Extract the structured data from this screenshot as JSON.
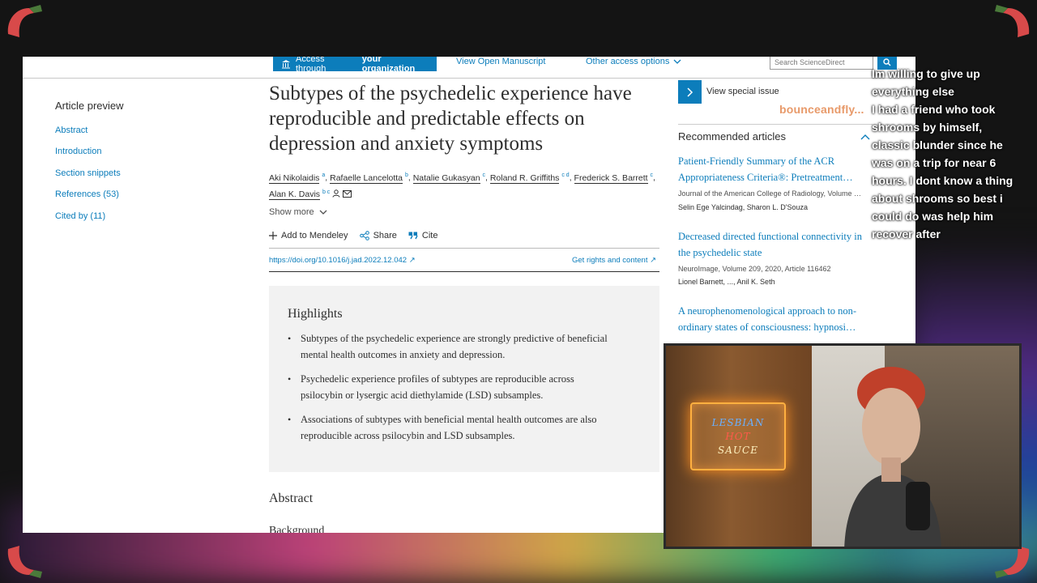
{
  "topbar": {
    "access_prefix": "Access through",
    "access_org": "your organization",
    "view_manuscript": "View Open Manuscript",
    "other_access": "Other access options",
    "search_placeholder": "Search ScienceDirect"
  },
  "nav": {
    "title": "Article preview",
    "items": [
      {
        "label": "Abstract"
      },
      {
        "label": "Introduction"
      },
      {
        "label": "Section snippets"
      },
      {
        "label": "References (53)"
      },
      {
        "label": "Cited by (11)"
      }
    ]
  },
  "article": {
    "title": "Subtypes of the psychedelic experience have reproducible and predictable effects on depression and anxiety symptoms",
    "authors": [
      {
        "name": "Aki Nikolaidis",
        "sup": "a"
      },
      {
        "name": "Rafaelle Lancelotta",
        "sup": "b"
      },
      {
        "name": "Natalie Gukasyan",
        "sup": "c"
      },
      {
        "name": "Roland R. Griffiths",
        "sup": "c d"
      },
      {
        "name": "Frederick S. Barrett",
        "sup": "c"
      },
      {
        "name": "Alan K. Davis",
        "sup": "b c"
      }
    ],
    "show_more": "Show more",
    "actions": {
      "mendeley": "Add to Mendeley",
      "share": "Share",
      "cite": "Cite"
    },
    "doi": "https://doi.org/10.1016/j.jad.2022.12.042",
    "rights": "Get rights and content",
    "highlights_title": "Highlights",
    "highlights": [
      "Subtypes of the psychedelic experience are strongly predictive of beneficial mental health outcomes in anxiety and depression.",
      "Psychedelic experience profiles of subtypes are reproducible across psilocybin or lysergic acid diethylamide (LSD) subsamples.",
      "Associations of subtypes with beneficial mental health outcomes are also reproducible across psilocybin and LSD subsamples."
    ],
    "abstract_heading": "Abstract",
    "background_heading": "Background"
  },
  "sidebar": {
    "special_issue": "View special issue",
    "recommended_title": "Recommended articles",
    "recommended": [
      {
        "title": "Patient-Friendly Summary of the ACR Appropriateness Criteria®: Pretreatment…",
        "journal": "Journal of the American College of Radiology, Volume …",
        "authors": "Selin Ege Yalcindag, Sharon L. D'Souza"
      },
      {
        "title": "Decreased directed functional connectivity in the psychedelic state",
        "journal": "NeuroImage, Volume 209, 2020, Article 116462",
        "authors": "Lionel Barnett, ..., Anil K. Seth"
      },
      {
        "title": "A neurophenomenological approach to non-ordinary states of consciousness: hypnosi…",
        "journal": "",
        "authors": ""
      }
    ]
  },
  "overlay": {
    "username": "bounceandfly...",
    "chat_lines": [
      "Im willing to give up",
      "everything else",
      "I had a friend who took",
      "shrooms by himself,",
      "classic blunder since he",
      "was on a trip for near 6",
      "hours. I dont know a thing",
      "about shrooms so best i",
      "could do was help him",
      "recover after"
    ],
    "neon_sign": [
      "LESBIAN",
      "HOT",
      "SAUCE"
    ]
  },
  "colors": {
    "link": "#0c7dbb",
    "text": "#2e2e2e",
    "highlight_bg": "#f2f2f2"
  }
}
